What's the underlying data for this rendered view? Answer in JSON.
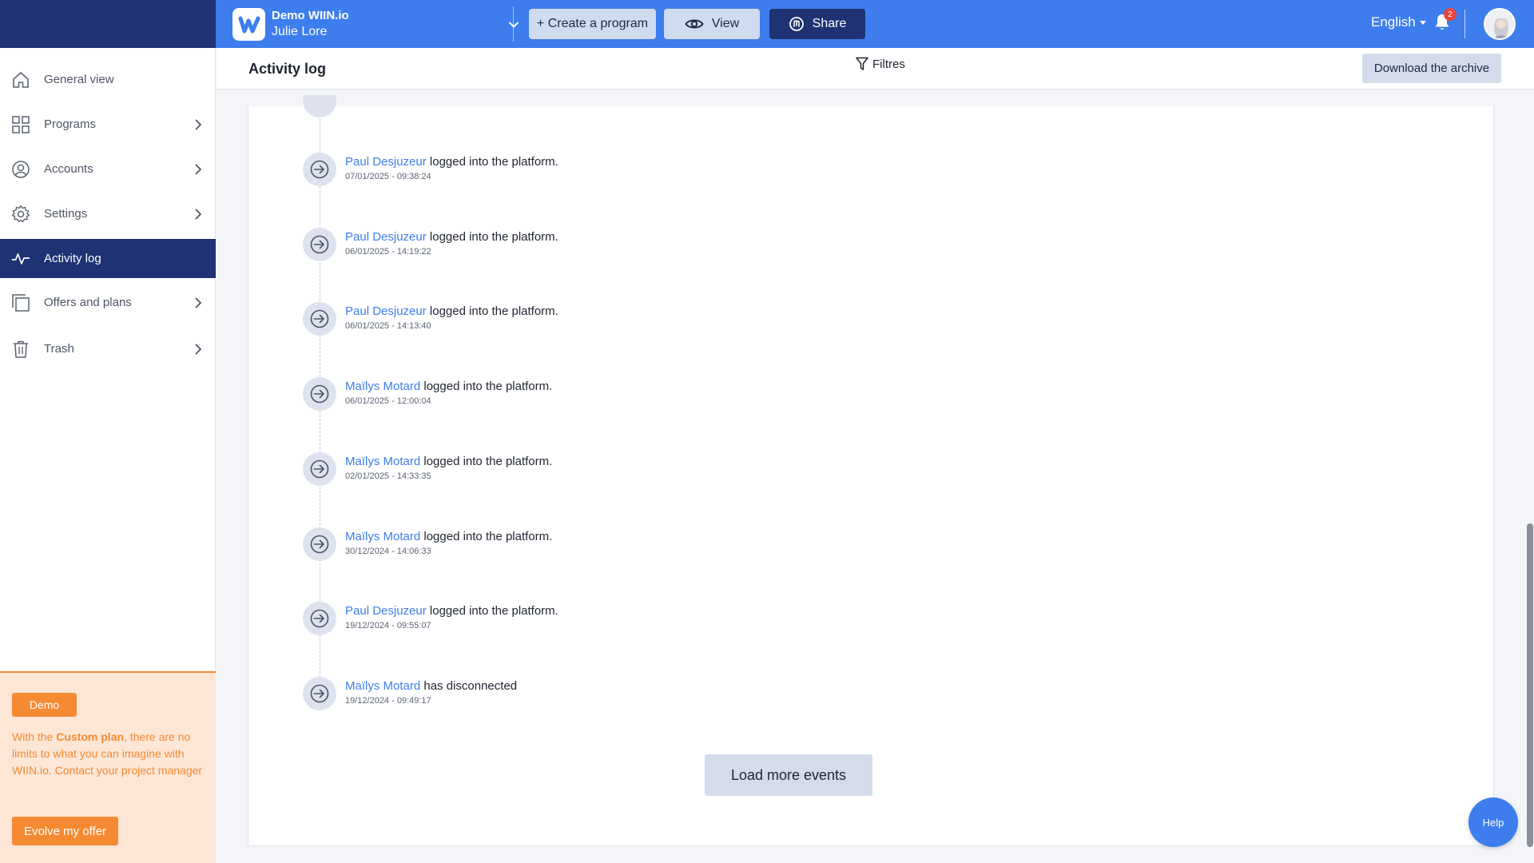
{
  "app": {
    "brand_name": "Demo WIIN.io",
    "user_name": "Julie Lore"
  },
  "toolbar": {
    "create_label": "+ Create a program",
    "view_label": "View",
    "share_label": "Share",
    "language": "English",
    "notification_count": "2"
  },
  "sidebar": {
    "items": [
      {
        "label": "General view",
        "icon": "home-icon"
      },
      {
        "label": "Programs",
        "icon": "grid-icon"
      },
      {
        "label": "Accounts",
        "icon": "user-circle-icon"
      },
      {
        "label": "Settings",
        "icon": "gear-icon"
      },
      {
        "label": "Activity log",
        "icon": "activity-icon"
      },
      {
        "label": "Offers and plans",
        "icon": "copy-icon"
      },
      {
        "label": "Trash",
        "icon": "trash-icon"
      }
    ],
    "active_item": "Activity log"
  },
  "promo": {
    "badge": "Demo",
    "text_before": "With the ",
    "text_bold": "Custom plan",
    "text_after": ", there are no limits to what you can imagine with WIIN.io. Contact your project manager",
    "button": "Evolve my offer"
  },
  "page": {
    "title": "Activity log",
    "filters_label": "Filtres",
    "download_label": "Download the archive"
  },
  "log": {
    "entries": [
      {
        "user": "Paul Desjuzeur",
        "action": "logged into the platform.",
        "timestamp": "07/01/2025 - 09:38:24"
      },
      {
        "user": "Paul Desjuzeur",
        "action": "logged into the platform.",
        "timestamp": "06/01/2025 - 14:19:22"
      },
      {
        "user": "Paul Desjuzeur",
        "action": "logged into the platform.",
        "timestamp": "06/01/2025 - 14:13:40"
      },
      {
        "user": "Maïlys Motard",
        "action": "logged into the platform.",
        "timestamp": "06/01/2025 - 12:00:04"
      },
      {
        "user": "Maïlys Motard",
        "action": "logged into the platform.",
        "timestamp": "02/01/2025 - 14:33:35"
      },
      {
        "user": "Maïlys Motard",
        "action": "logged into the platform.",
        "timestamp": "30/12/2024 - 14:06:33"
      },
      {
        "user": "Paul Desjuzeur",
        "action": "logged into the platform.",
        "timestamp": "19/12/2024 - 09:55:07"
      },
      {
        "user": "Maïlys Motard",
        "action": "has disconnected",
        "timestamp": "19/12/2024 - 09:49:17"
      }
    ],
    "load_more_label": "Load more events"
  },
  "help_label": "Help",
  "colors": {
    "primary": "#3d7ded",
    "navy": "#1e3274",
    "accent_orange": "#f68a33",
    "promo_bg": "#fde6d6"
  }
}
